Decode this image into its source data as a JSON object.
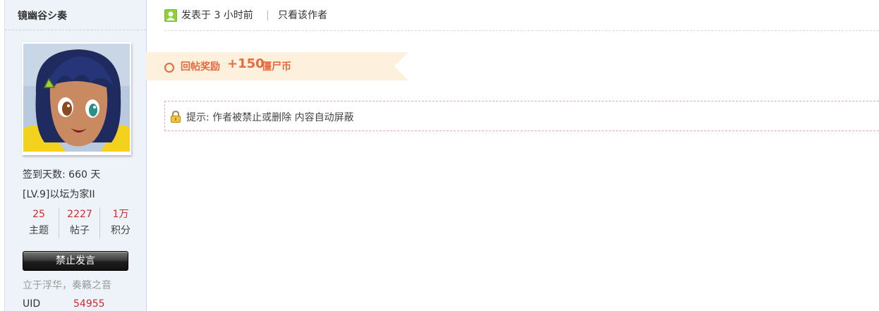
{
  "author": {
    "name": "镜幽谷シ奏"
  },
  "profile": {
    "sign_days": "签到天数: 660 天",
    "level": "[LV.9]以坛为家II",
    "stats": [
      {
        "value": "25",
        "label": "主题"
      },
      {
        "value": "2227",
        "label": "帖子"
      },
      {
        "value": "1万",
        "label": "积分"
      }
    ],
    "ban_button": "禁止发言",
    "motto": "立于浮华，奏籁之音",
    "uid_label": "UID",
    "uid_value": "54955"
  },
  "post": {
    "posted_time": "发表于 3 小时前",
    "divider": "|",
    "only_author": "只看该作者",
    "reward": {
      "label": "回帖奖励",
      "amount": "+150",
      "unit": "僵尸币"
    },
    "notice": "提示: 作者被禁止或删除 内容自动屏蔽"
  },
  "colors": {
    "sidebar_bg": "#eef3fa",
    "accent_red": "#cc2b2b",
    "reward_orange": "#e86a3d",
    "reward_bg": "#fdf1de",
    "notice_border": "#e8a8c0"
  },
  "icons": {
    "post_meta": "user-icon",
    "reward": "circle-icon",
    "notice": "lock-icon"
  }
}
